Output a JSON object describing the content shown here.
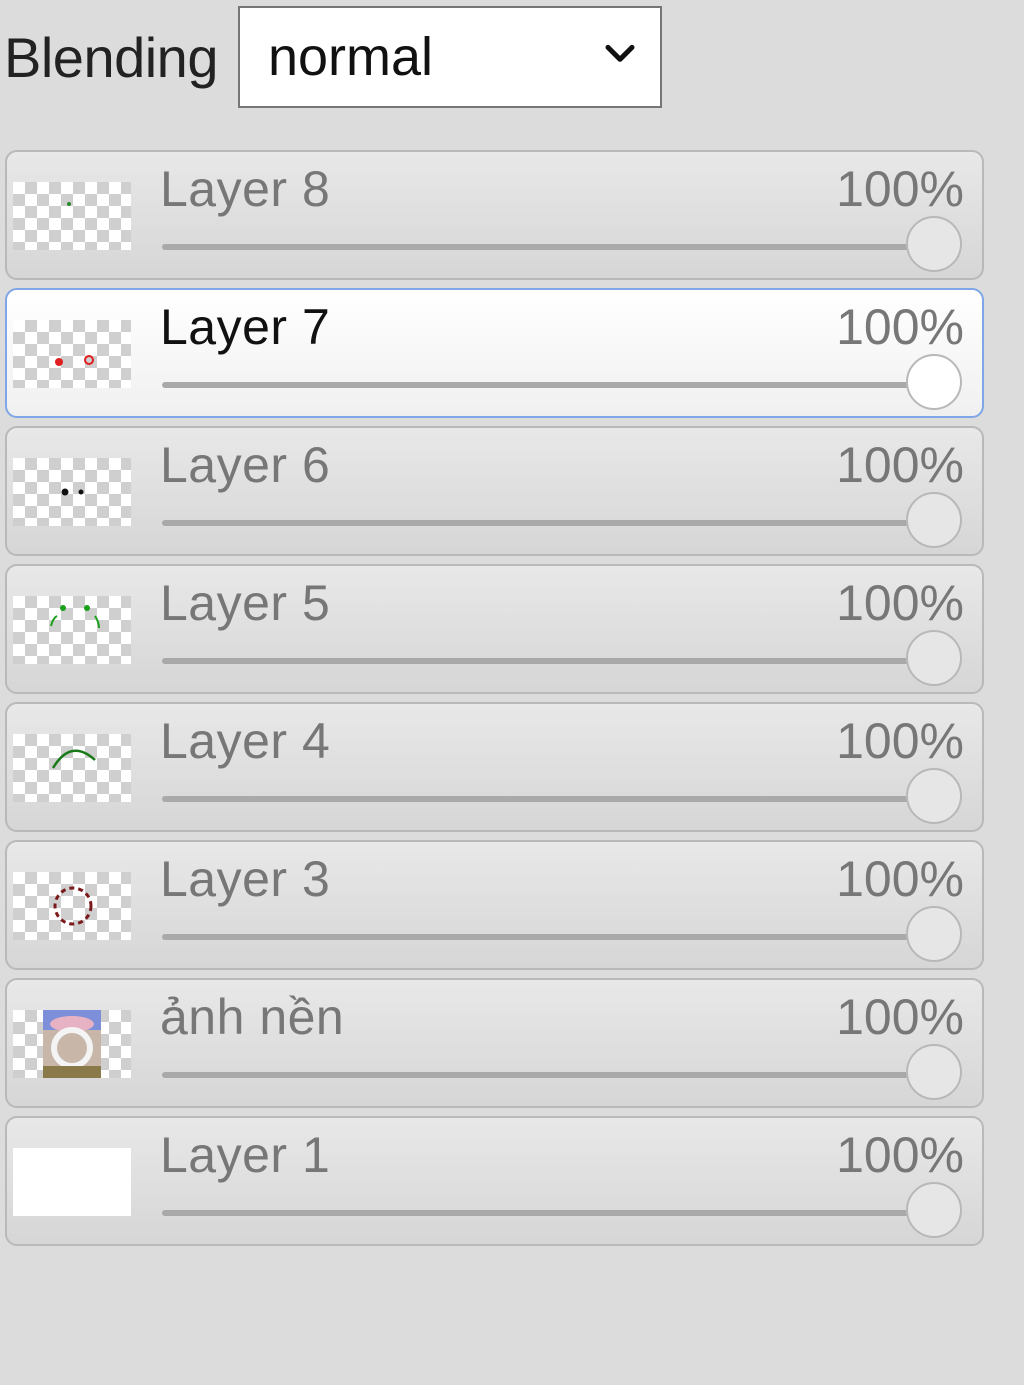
{
  "blending": {
    "label": "Blending",
    "selected": "normal"
  },
  "layers": [
    {
      "name": "Layer 8",
      "opacity_label": "100%",
      "opacity": 1.0,
      "active": false,
      "thumb": "dot-green-small"
    },
    {
      "name": "Layer 7",
      "opacity_label": "100%",
      "opacity": 1.0,
      "active": true,
      "thumb": "dots-red"
    },
    {
      "name": "Layer 6",
      "opacity_label": "100%",
      "opacity": 1.0,
      "active": false,
      "thumb": "dots-black"
    },
    {
      "name": "Layer 5",
      "opacity_label": "100%",
      "opacity": 1.0,
      "active": false,
      "thumb": "dots-green"
    },
    {
      "name": "Layer 4",
      "opacity_label": "100%",
      "opacity": 1.0,
      "active": false,
      "thumb": "arc-green"
    },
    {
      "name": "Layer 3",
      "opacity_label": "100%",
      "opacity": 1.0,
      "active": false,
      "thumb": "circle-dashed-red"
    },
    {
      "name": "ảnh nền",
      "opacity_label": "100%",
      "opacity": 1.0,
      "active": false,
      "thumb": "photo-background"
    },
    {
      "name": "Layer 1",
      "opacity_label": "100%",
      "opacity": 1.0,
      "active": false,
      "thumb": "solid-white"
    }
  ]
}
